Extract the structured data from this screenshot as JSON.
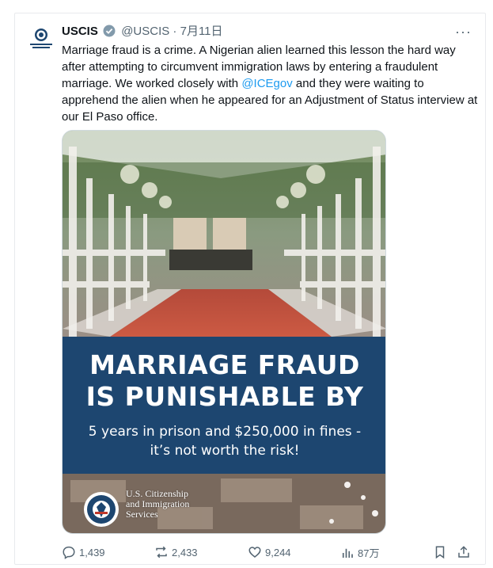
{
  "account": {
    "name": "USCIS",
    "handle": "@USCIS",
    "date": "7月11日"
  },
  "tweet": {
    "text_before": "Marriage fraud is a crime. A Nigerian alien learned this lesson the hard way after attempting to circumvent immigration laws by entering a fraudulent marriage. We worked closely with ",
    "mention": "@ICEgov",
    "text_after": " and they were waiting to apprehend the alien when he appeared for an Adjustment of Status interview at our El Paso office."
  },
  "media": {
    "headline_line1": "MARRIAGE FRAUD",
    "headline_line2": "IS PUNISHABLE BY",
    "sub_line1": "5 years in prison and $250,000 in fines -",
    "sub_line2": "it’s not worth the risk!",
    "agency_line1": "U.S. Citizenship",
    "agency_line2": "and Immigration",
    "agency_line3": "Services"
  },
  "actions": {
    "replies": "1,439",
    "reposts": "2,433",
    "likes": "9,244",
    "views": "87万"
  },
  "colors": {
    "banner": "#1d4670",
    "link": "#1d9bf0",
    "verified": "#829aab",
    "muted": "#536471"
  },
  "icons": [
    "uscis-seal-icon",
    "verified-badge-icon",
    "more-icon",
    "reply-icon",
    "repost-icon",
    "like-icon",
    "views-icon",
    "bookmark-icon",
    "share-icon"
  ]
}
